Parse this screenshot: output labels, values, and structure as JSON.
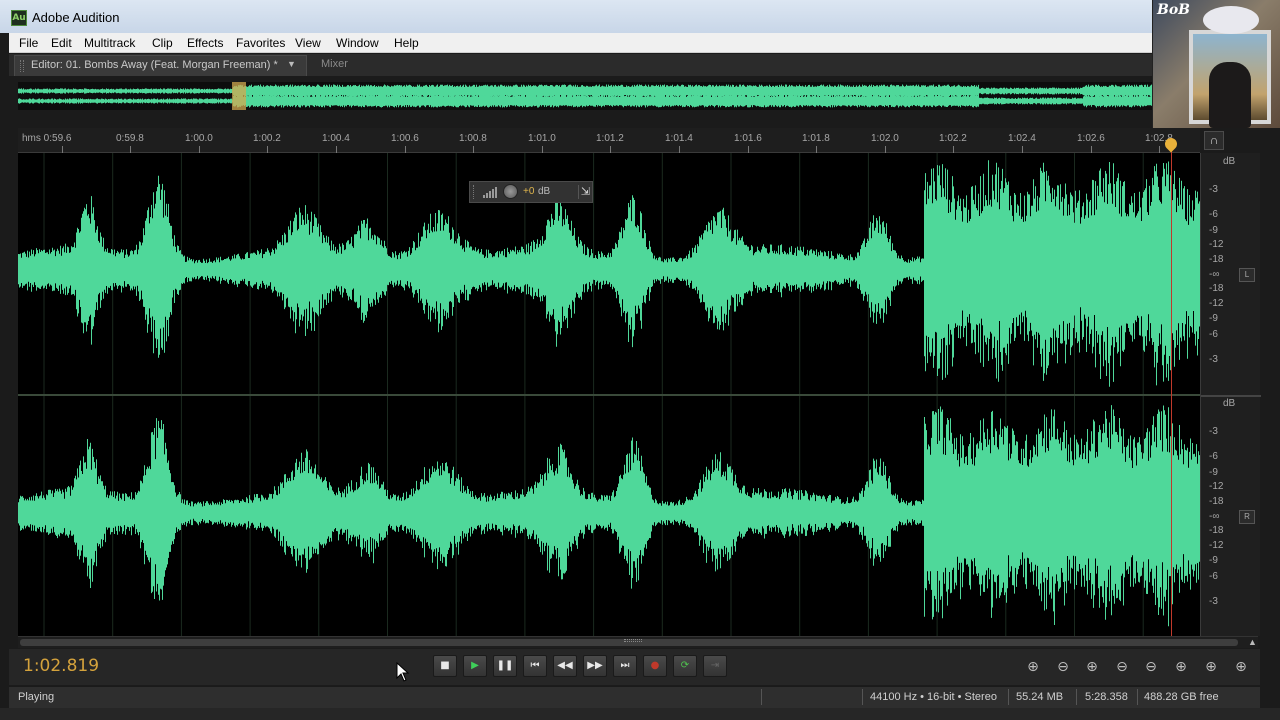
{
  "window": {
    "title": "Adobe Audition",
    "icon_text": "Au"
  },
  "thumbnail": {
    "logo_text": "BoB"
  },
  "menu": [
    "File",
    "Edit",
    "Multitrack",
    "Clip",
    "Effects",
    "Favorites",
    "View",
    "Window",
    "Help"
  ],
  "tabs": {
    "editor": "Editor: 01. Bombs Away (Feat. Morgan Freeman) *",
    "mixer": "Mixer"
  },
  "ruler": {
    "labels": [
      "hms 0:59.6",
      "0:59.8",
      "1:00.0",
      "1:00.2",
      "1:00.4",
      "1:00.6",
      "1:00.8",
      "1:01.0",
      "1:01.2",
      "1:01.4",
      "1:01.6",
      "1:01.8",
      "1:02.0",
      "1:02.2",
      "1:02.4",
      "1:02.6",
      "1:02.8"
    ]
  },
  "overlay": {
    "level_value": "+0",
    "level_unit": "dB"
  },
  "db_scale": {
    "top": {
      "header": "dB",
      "labels": [
        "-3",
        "-6",
        "-9",
        "-12",
        "-18",
        "-∞",
        "-18",
        "-12",
        "-9",
        "-6",
        "-3"
      ],
      "channel": "L"
    },
    "bottom": {
      "header": "dB",
      "labels": [
        "-3",
        "-6",
        "-9",
        "-12",
        "-18",
        "-∞",
        "-18",
        "-12",
        "-9",
        "-6",
        "-3"
      ],
      "channel": "R"
    }
  },
  "transport": {
    "time": "1:02.819",
    "buttons": [
      "stop",
      "play",
      "pause",
      "go-to-start",
      "rewind",
      "fast-forward",
      "go-to-end",
      "record",
      "loop",
      "skip-selection"
    ]
  },
  "status": {
    "state": "Playing",
    "format": "44100 Hz • 16-bit • Stereo",
    "size": "55.24 MB",
    "duration": "5:28.358",
    "free": "488.28 GB free"
  },
  "colors": {
    "waveform": "#4fd89a",
    "time_display": "#d4a23c",
    "playhead": "#c0392b",
    "background": "#000000"
  }
}
